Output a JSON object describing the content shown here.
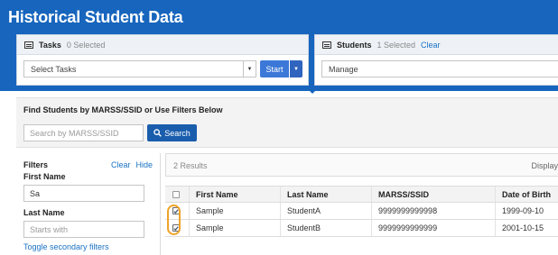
{
  "app": {
    "title": "Historical Student Data"
  },
  "tasks": {
    "title": "Tasks",
    "selected_text": "0 Selected",
    "select_placeholder": "Select Tasks",
    "start_label": "Start"
  },
  "students": {
    "title": "Students",
    "selected_text": "1 Selected",
    "clear_label": "Clear",
    "manage_label": "Manage"
  },
  "find": {
    "title": "Find Students by MARSS/SSID or Use Filters Below",
    "search_placeholder": "Search by MARSS/SSID",
    "search_button": "Search"
  },
  "filters": {
    "title": "Filters",
    "clear_label": "Clear",
    "hide_label": "Hide",
    "first_name_label": "First Name",
    "first_name_value": "Sa",
    "last_name_label": "Last Name",
    "last_name_placeholder": "Starts with",
    "toggle_label": "Toggle secondary filters"
  },
  "results": {
    "count_text": "2 Results",
    "display_text": "Display",
    "columns": [
      "",
      "First Name",
      "Last Name",
      "MARSS/SSID",
      "Date of Birth"
    ],
    "rows": [
      {
        "checked": true,
        "first": "Sample",
        "last": "StudentA",
        "ssid": "9999999999998",
        "dob": "1999-09-10"
      },
      {
        "checked": true,
        "first": "Sample",
        "last": "StudentB",
        "ssid": "9999999999999",
        "dob": "2001-10-15"
      }
    ]
  },
  "colors": {
    "brand_blue": "#1765bd",
    "button_blue": "#3c78d8",
    "link_blue": "#1a72c4",
    "highlight_orange": "#f0a32a"
  },
  "icons": {
    "tasks": "list-icon",
    "students": "list-icon",
    "search": "magnifier-icon",
    "dropdown": "caret-down-icon",
    "checkbox": "checkmark-icon"
  }
}
